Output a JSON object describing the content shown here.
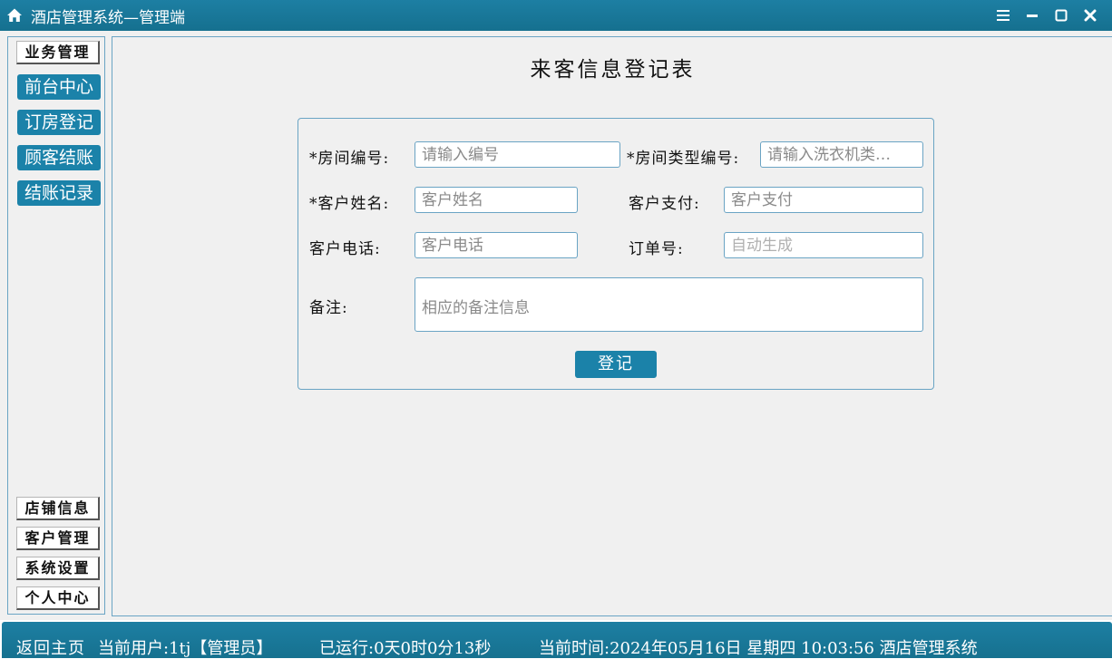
{
  "window": {
    "title": "酒店管理系统—管理端",
    "controls": [
      "menu-icon",
      "minimize-icon",
      "maximize-icon",
      "close-icon"
    ]
  },
  "sidebar": {
    "top_section": "业务管理",
    "items": [
      {
        "label": "前台中心"
      },
      {
        "label": "订房登记"
      },
      {
        "label": "顾客结账"
      },
      {
        "label": "结账记录"
      }
    ],
    "bottom_sections": [
      {
        "label": "店铺信息"
      },
      {
        "label": "客户管理"
      },
      {
        "label": "系统设置"
      },
      {
        "label": "个人中心"
      }
    ]
  },
  "form": {
    "title": "来客信息登记表",
    "fields": {
      "room_no": {
        "label": "*房间编号:",
        "placeholder": "请输入编号",
        "value": ""
      },
      "room_type": {
        "label": "*房间类型编号:",
        "placeholder": "请输入洗衣机类…",
        "value": ""
      },
      "customer_name": {
        "label": "*客户姓名:",
        "placeholder": "客户姓名",
        "value": ""
      },
      "customer_payment": {
        "label": "客户支付:",
        "placeholder": "客户支付",
        "value": ""
      },
      "customer_phone": {
        "label": "客户电话:",
        "placeholder": "客户电话",
        "value": ""
      },
      "order_no": {
        "label": "订单号:",
        "placeholder": "自动生成",
        "value": ""
      },
      "notes": {
        "label": "备注:",
        "placeholder": "相应的备注信息",
        "value": ""
      }
    },
    "submit_label": "登记"
  },
  "statusbar": {
    "home_link": "返回主页",
    "current_user": "当前用户:1tj【管理员】",
    "uptime": "已运行:0天0时0分13秒",
    "current_time": "当前时间:2024年05月16日 星期四 10:03:56 酒店管理系统"
  },
  "colors": {
    "accent": "#1b82a9",
    "titlebar": "#1a7a9c",
    "panel_border": "#6aa4c4",
    "background": "#f0f0f0"
  }
}
